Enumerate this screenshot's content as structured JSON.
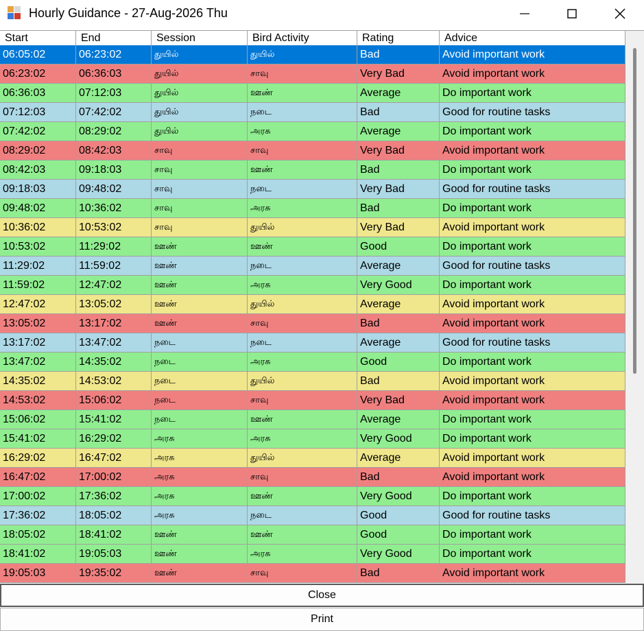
{
  "window": {
    "title": "Hourly Guidance - 27-Aug-2026 Thu",
    "icon": "app-grid-icon"
  },
  "colors": {
    "selected": "#0078d7",
    "bad_red": "#f08080",
    "green": "#90ee90",
    "blue": "#add8e6",
    "yellow": "#f0e68c"
  },
  "columns": [
    "Start",
    "End",
    "Session",
    "Bird Activity",
    "Rating",
    "Advice"
  ],
  "rows": [
    {
      "start": "06:05:02",
      "end": "06:23:02",
      "session": "துயில்",
      "bird_activity": "துயில்",
      "rating": "Bad",
      "advice": "Avoid important work",
      "color": "#0078d7",
      "selected": true
    },
    {
      "start": "06:23:02",
      "end": "06:36:03",
      "session": "துயில்",
      "bird_activity": "சாவு",
      "rating": "Very Bad",
      "advice": "Avoid important work",
      "color": "#f08080"
    },
    {
      "start": "06:36:03",
      "end": "07:12:03",
      "session": "துயில்",
      "bird_activity": "ஊண்",
      "rating": "Average",
      "advice": "Do important work",
      "color": "#90ee90"
    },
    {
      "start": "07:12:03",
      "end": "07:42:02",
      "session": "துயில்",
      "bird_activity": "நடை",
      "rating": "Bad",
      "advice": "Good for routine tasks",
      "color": "#add8e6"
    },
    {
      "start": "07:42:02",
      "end": "08:29:02",
      "session": "துயில்",
      "bird_activity": "அரசு",
      "rating": "Average",
      "advice": "Do important work",
      "color": "#90ee90"
    },
    {
      "start": "08:29:02",
      "end": "08:42:03",
      "session": "சாவு",
      "bird_activity": "சாவு",
      "rating": "Very Bad",
      "advice": "Avoid important work",
      "color": "#f08080"
    },
    {
      "start": "08:42:03",
      "end": "09:18:03",
      "session": "சாவு",
      "bird_activity": "ஊண்",
      "rating": "Bad",
      "advice": "Do important work",
      "color": "#90ee90"
    },
    {
      "start": "09:18:03",
      "end": "09:48:02",
      "session": "சாவு",
      "bird_activity": "நடை",
      "rating": "Very Bad",
      "advice": "Good for routine tasks",
      "color": "#add8e6"
    },
    {
      "start": "09:48:02",
      "end": "10:36:02",
      "session": "சாவு",
      "bird_activity": "அரசு",
      "rating": "Bad",
      "advice": "Do important work",
      "color": "#90ee90"
    },
    {
      "start": "10:36:02",
      "end": "10:53:02",
      "session": "சாவு",
      "bird_activity": "துயில்",
      "rating": "Very Bad",
      "advice": "Avoid important work",
      "color": "#f0e68c"
    },
    {
      "start": "10:53:02",
      "end": "11:29:02",
      "session": "ஊண்",
      "bird_activity": "ஊண்",
      "rating": "Good",
      "advice": "Do important work",
      "color": "#90ee90"
    },
    {
      "start": "11:29:02",
      "end": "11:59:02",
      "session": "ஊண்",
      "bird_activity": "நடை",
      "rating": "Average",
      "advice": "Good for routine tasks",
      "color": "#add8e6"
    },
    {
      "start": "11:59:02",
      "end": "12:47:02",
      "session": "ஊண்",
      "bird_activity": "அரசு",
      "rating": "Very Good",
      "advice": "Do important work",
      "color": "#90ee90"
    },
    {
      "start": "12:47:02",
      "end": "13:05:02",
      "session": "ஊண்",
      "bird_activity": "துயில்",
      "rating": "Average",
      "advice": "Avoid important work",
      "color": "#f0e68c"
    },
    {
      "start": "13:05:02",
      "end": "13:17:02",
      "session": "ஊண்",
      "bird_activity": "சாவு",
      "rating": "Bad",
      "advice": "Avoid important work",
      "color": "#f08080"
    },
    {
      "start": "13:17:02",
      "end": "13:47:02",
      "session": "நடை",
      "bird_activity": "நடை",
      "rating": "Average",
      "advice": "Good for routine tasks",
      "color": "#add8e6"
    },
    {
      "start": "13:47:02",
      "end": "14:35:02",
      "session": "நடை",
      "bird_activity": "அரசு",
      "rating": "Good",
      "advice": "Do important work",
      "color": "#90ee90"
    },
    {
      "start": "14:35:02",
      "end": "14:53:02",
      "session": "நடை",
      "bird_activity": "துயில்",
      "rating": "Bad",
      "advice": "Avoid important work",
      "color": "#f0e68c"
    },
    {
      "start": "14:53:02",
      "end": "15:06:02",
      "session": "நடை",
      "bird_activity": "சாவு",
      "rating": "Very Bad",
      "advice": "Avoid important work",
      "color": "#f08080"
    },
    {
      "start": "15:06:02",
      "end": "15:41:02",
      "session": "நடை",
      "bird_activity": "ஊண்",
      "rating": "Average",
      "advice": "Do important work",
      "color": "#90ee90"
    },
    {
      "start": "15:41:02",
      "end": "16:29:02",
      "session": "அரசு",
      "bird_activity": "அரசு",
      "rating": "Very Good",
      "advice": "Do important work",
      "color": "#90ee90"
    },
    {
      "start": "16:29:02",
      "end": "16:47:02",
      "session": "அரசு",
      "bird_activity": "துயில்",
      "rating": "Average",
      "advice": "Avoid important work",
      "color": "#f0e68c"
    },
    {
      "start": "16:47:02",
      "end": "17:00:02",
      "session": "அரசு",
      "bird_activity": "சாவு",
      "rating": "Bad",
      "advice": "Avoid important work",
      "color": "#f08080"
    },
    {
      "start": "17:00:02",
      "end": "17:36:02",
      "session": "அரசு",
      "bird_activity": "ஊண்",
      "rating": "Very Good",
      "advice": "Do important work",
      "color": "#90ee90"
    },
    {
      "start": "17:36:02",
      "end": "18:05:02",
      "session": "அரசு",
      "bird_activity": "நடை",
      "rating": "Good",
      "advice": "Good for routine tasks",
      "color": "#add8e6"
    },
    {
      "start": "18:05:02",
      "end": "18:41:02",
      "session": "ஊண்",
      "bird_activity": "ஊண்",
      "rating": "Good",
      "advice": "Do important work",
      "color": "#90ee90"
    },
    {
      "start": "18:41:02",
      "end": "19:05:03",
      "session": "ஊண்",
      "bird_activity": "அரசு",
      "rating": "Very Good",
      "advice": "Do important work",
      "color": "#90ee90"
    },
    {
      "start": "19:05:03",
      "end": "19:35:02",
      "session": "ஊண்",
      "bird_activity": "சாவு",
      "rating": "Bad",
      "advice": "Avoid important work",
      "color": "#f08080"
    }
  ],
  "buttons": {
    "close_label": "Close",
    "print_label": "Print"
  }
}
